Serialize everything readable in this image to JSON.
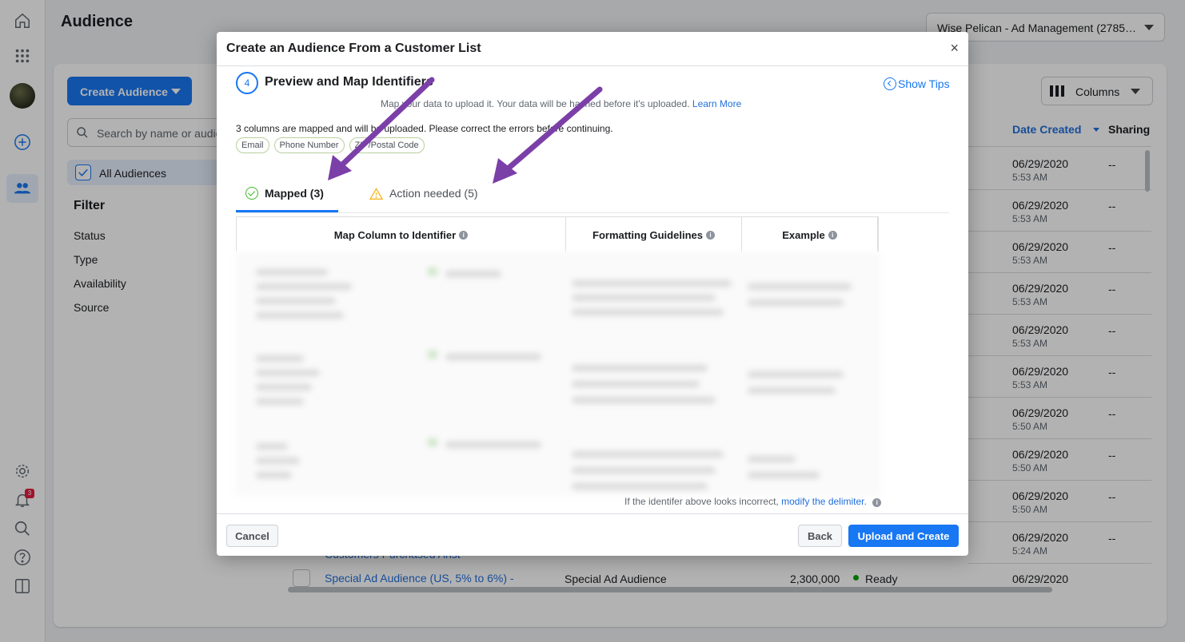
{
  "page": {
    "title": "Audience",
    "account_selector": "Wise Pelican - Ad Management (2785…"
  },
  "nav": {
    "notification_count": "3"
  },
  "toolbar": {
    "create_audience": "Create Audience",
    "search_placeholder": "Search by name or audience",
    "all_audiences": "All Audiences",
    "columns": "Columns"
  },
  "filter": {
    "heading": "Filter",
    "items": [
      "Status",
      "Type",
      "Availability",
      "Source"
    ]
  },
  "table": {
    "date_created": "Date Created",
    "sharing": "Sharing",
    "rows": [
      {
        "date": "06/29/2020",
        "time": "5:53 AM",
        "sharing": "--"
      },
      {
        "date": "06/29/2020",
        "time": "5:53 AM",
        "sharing": "--"
      },
      {
        "date": "06/29/2020",
        "time": "5:53 AM",
        "sharing": "--"
      },
      {
        "date": "06/29/2020",
        "time": "5:53 AM",
        "sharing": "--"
      },
      {
        "date": "06/29/2020",
        "time": "5:53 AM",
        "sharing": "--"
      },
      {
        "date": "06/29/2020",
        "time": "5:53 AM",
        "sharing": "--"
      },
      {
        "date": "06/29/2020",
        "time": "5:50 AM",
        "sharing": "--"
      },
      {
        "date": "06/29/2020",
        "time": "5:50 AM",
        "sharing": "--"
      },
      {
        "date": "06/29/2020",
        "time": "5:50 AM",
        "sharing": "--"
      },
      {
        "date": "06/29/2020",
        "time": "5:24 AM",
        "sharing": "--"
      },
      {
        "date": "06/29/2020",
        "time": "",
        "sharing": ""
      }
    ],
    "peek_row_name": "Customers Purchased Anst",
    "last_row": {
      "name": "Special Ad Audience (US, 5% to 6%) -",
      "type": "Special Ad Audience",
      "size": "2,300,000",
      "status": "Ready"
    }
  },
  "modal": {
    "title": "Create an Audience From a Customer List",
    "close": "×",
    "step_number": "4",
    "step_title": "Preview and Map Identifiers",
    "show_tips": "Show Tips",
    "subtitle": "Map your data to upload it. Your data will be hashed before it's uploaded.",
    "learn_more": "Learn More",
    "mapped_message": "3 columns are mapped and will be uploaded. Please correct the errors before continuing.",
    "chips": [
      "Email",
      "Phone Number",
      "ZIP/Postal Code"
    ],
    "tabs": {
      "mapped": "Mapped (3)",
      "action_needed": "Action needed (5)"
    },
    "columns": {
      "map_column": "Map Column to Identifier",
      "formatting": "Formatting Guidelines",
      "example": "Example"
    },
    "delimiter_note": "If the identifer above looks incorrect,",
    "delimiter_link": "modify the delimiter.",
    "buttons": {
      "cancel": "Cancel",
      "back": "Back",
      "upload": "Upload and Create"
    }
  },
  "colors": {
    "accent": "#1877f2",
    "success": "#42b72a",
    "warning": "#f7b928",
    "annotation_arrow": "#7b3fa8"
  }
}
